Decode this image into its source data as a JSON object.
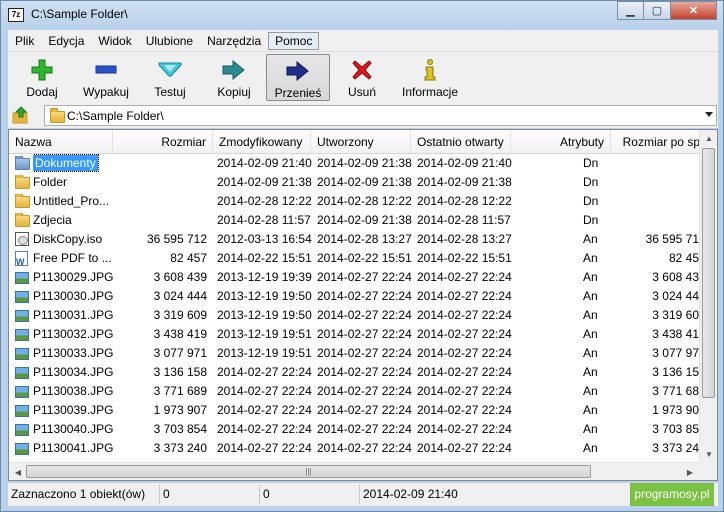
{
  "window": {
    "title": "C:\\Sample Folder\\",
    "app_icon_text": "7z",
    "minimize_label": "▁",
    "maximize_label": "▢",
    "close_label": "✕"
  },
  "menu": [
    "Plik",
    "Edycja",
    "Widok",
    "Ulubione",
    "Narzędzia",
    "Pomoc"
  ],
  "toolbar": {
    "add": "Dodaj",
    "extract": "Wypakuj",
    "test": "Testuj",
    "copy": "Kopiuj",
    "move": "Przenieś",
    "delete": "Usuń",
    "info": "Informacje"
  },
  "address": {
    "path": "C:\\Sample Folder\\"
  },
  "columns": {
    "name": "Nazwa",
    "size": "Rozmiar",
    "modified": "Zmodyfikowany",
    "created": "Utworzony",
    "accessed": "Ostatnio otwarty",
    "attributes": "Atrybuty",
    "packed": "Rozmiar po sp..."
  },
  "rows": [
    {
      "icon": "folder-docs",
      "name": "Dokumenty",
      "size": "",
      "modified": "2014-02-09 21:40",
      "created": "2014-02-09 21:38",
      "accessed": "2014-02-09 21:40",
      "attr": "Dn",
      "packed": ""
    },
    {
      "icon": "folder",
      "name": "Folder",
      "size": "",
      "modified": "2014-02-09 21:38",
      "created": "2014-02-09 21:38",
      "accessed": "2014-02-09 21:38",
      "attr": "Dn",
      "packed": ""
    },
    {
      "icon": "folder",
      "name": "Untitled_Pro...",
      "size": "",
      "modified": "2014-02-28 12:22",
      "created": "2014-02-28 12:22",
      "accessed": "2014-02-28 12:22",
      "attr": "Dn",
      "packed": ""
    },
    {
      "icon": "folder",
      "name": "Zdjecia",
      "size": "",
      "modified": "2014-02-28 11:57",
      "created": "2014-02-09 21:38",
      "accessed": "2014-02-28 11:57",
      "attr": "Dn",
      "packed": ""
    },
    {
      "icon": "iso",
      "name": "DiskCopy.iso",
      "size": "36 595 712",
      "modified": "2012-03-13 16:54",
      "created": "2014-02-28 13:27",
      "accessed": "2014-02-28 13:27",
      "attr": "An",
      "packed": "36 595 71"
    },
    {
      "icon": "doc",
      "name": "Free PDF to ...",
      "size": "82 457",
      "modified": "2014-02-22 15:51",
      "created": "2014-02-22 15:51",
      "accessed": "2014-02-22 15:51",
      "attr": "An",
      "packed": "82 45"
    },
    {
      "icon": "image",
      "name": "P1130029.JPG",
      "size": "3 608 439",
      "modified": "2013-12-19 19:39",
      "created": "2014-02-27 22:24",
      "accessed": "2014-02-27 22:24",
      "attr": "An",
      "packed": "3 608 43"
    },
    {
      "icon": "image",
      "name": "P1130030.JPG",
      "size": "3 024 444",
      "modified": "2013-12-19 19:50",
      "created": "2014-02-27 22:24",
      "accessed": "2014-02-27 22:24",
      "attr": "An",
      "packed": "3 024 44"
    },
    {
      "icon": "image",
      "name": "P1130031.JPG",
      "size": "3 319 609",
      "modified": "2013-12-19 19:50",
      "created": "2014-02-27 22:24",
      "accessed": "2014-02-27 22:24",
      "attr": "An",
      "packed": "3 319 60"
    },
    {
      "icon": "image",
      "name": "P1130032.JPG",
      "size": "3 438 419",
      "modified": "2013-12-19 19:51",
      "created": "2014-02-27 22:24",
      "accessed": "2014-02-27 22:24",
      "attr": "An",
      "packed": "3 438 41"
    },
    {
      "icon": "image",
      "name": "P1130033.JPG",
      "size": "3 077 971",
      "modified": "2013-12-19 19:51",
      "created": "2014-02-27 22:24",
      "accessed": "2014-02-27 22:24",
      "attr": "An",
      "packed": "3 077 97"
    },
    {
      "icon": "image",
      "name": "P1130034.JPG",
      "size": "3 136 158",
      "modified": "2014-02-27 22:24",
      "created": "2014-02-27 22:24",
      "accessed": "2014-02-27 22:24",
      "attr": "An",
      "packed": "3 136 15"
    },
    {
      "icon": "image",
      "name": "P1130038.JPG",
      "size": "3 771 689",
      "modified": "2014-02-27 22:24",
      "created": "2014-02-27 22:24",
      "accessed": "2014-02-27 22:24",
      "attr": "An",
      "packed": "3 771 68"
    },
    {
      "icon": "image",
      "name": "P1130039.JPG",
      "size": "1 973 907",
      "modified": "2014-02-27 22:24",
      "created": "2014-02-27 22:24",
      "accessed": "2014-02-27 22:24",
      "attr": "An",
      "packed": "1 973 90"
    },
    {
      "icon": "image",
      "name": "P1130040.JPG",
      "size": "3 703 854",
      "modified": "2014-02-27 22:24",
      "created": "2014-02-27 22:24",
      "accessed": "2014-02-27 22:24",
      "attr": "An",
      "packed": "3 703 85"
    },
    {
      "icon": "image",
      "name": "P1130041.JPG",
      "size": "3 373 240",
      "modified": "2014-02-27 22:24",
      "created": "2014-02-27 22:24",
      "accessed": "2014-02-27 22:24",
      "attr": "An",
      "packed": "3 373 24"
    }
  ],
  "scroll": {
    "h_grip": "|||"
  },
  "status": {
    "selected": "Zaznaczono 1 obiekt(ów)",
    "size": "0",
    "packed": "0",
    "date": "2014-02-09 21:40",
    "watermark": "programosy.pl"
  },
  "colors": {
    "selection": "#3399ff",
    "frame": "#b9d1ea",
    "watermark": "#7bc142"
  }
}
